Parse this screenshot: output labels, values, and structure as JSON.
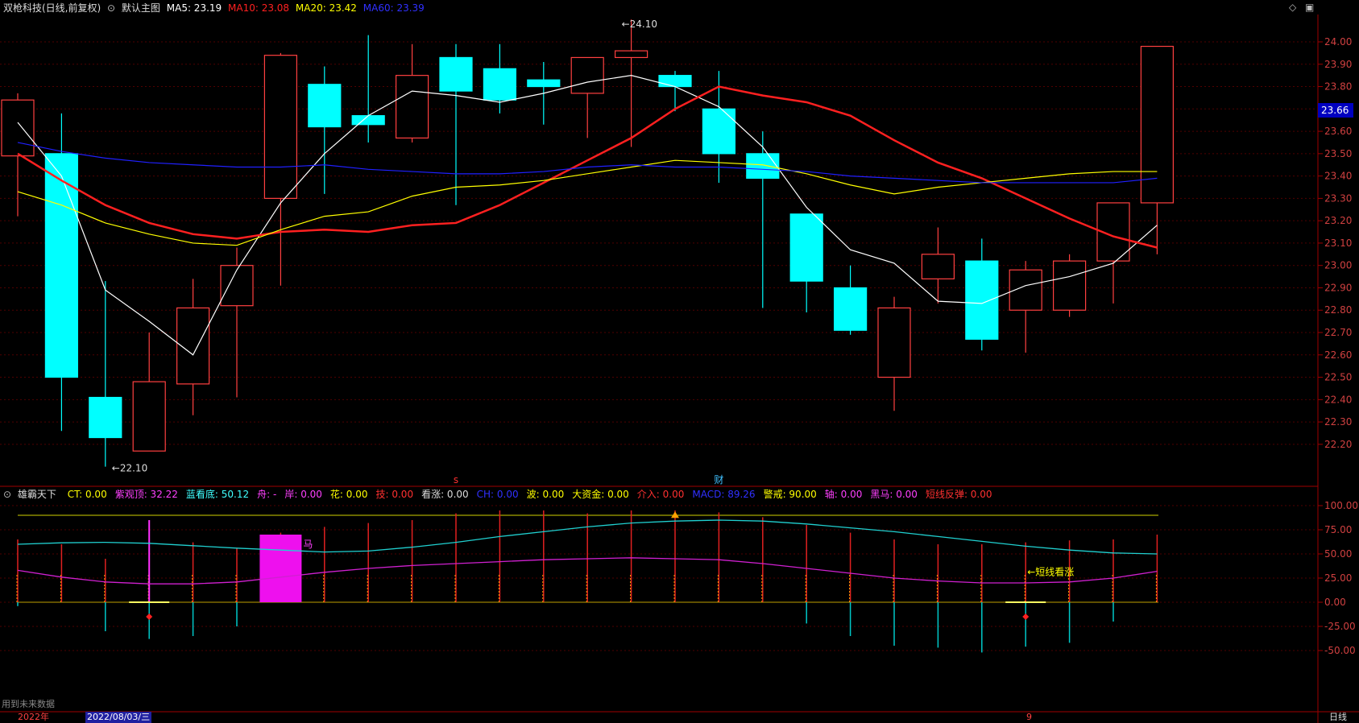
{
  "header": {
    "stock": "双枪科技(日线,前复权)",
    "main_label": "默认主图",
    "ma5": "MA5: 23.19",
    "ma10": "MA10: 23.08",
    "ma20": "MA20: 23.42",
    "ma60": "MA60: 23.39",
    "colors": {
      "ma5": "#ffffff",
      "ma10": "#ff2020",
      "ma20": "#ffff00",
      "ma60": "#3030ff"
    }
  },
  "indicator_header": {
    "name": "雄霸天下",
    "items": [
      {
        "text": "CT: 0.00",
        "color": "#ffff00"
      },
      {
        "text": "紫观顶: 32.22",
        "color": "#ff40ff"
      },
      {
        "text": "蓝看底: 50.12",
        "color": "#40ffff"
      },
      {
        "text": "舟: -",
        "color": "#ff40ff"
      },
      {
        "text": "岸: 0.00",
        "color": "#ff40ff"
      },
      {
        "text": "花: 0.00",
        "color": "#ffff00"
      },
      {
        "text": "技: 0.00",
        "color": "#ff3030"
      },
      {
        "text": "看涨: 0.00",
        "color": "#dddddd"
      },
      {
        "text": "CH: 0.00",
        "color": "#3030ff"
      },
      {
        "text": "波: 0.00",
        "color": "#ffff00"
      },
      {
        "text": "大资金: 0.00",
        "color": "#ffff00"
      },
      {
        "text": "介入: 0.00",
        "color": "#ff3030"
      },
      {
        "text": "MACD: 89.26",
        "color": "#3030ff"
      },
      {
        "text": "警戒: 90.00",
        "color": "#ffff00"
      },
      {
        "text": "轴: 0.00",
        "color": "#ff40ff"
      },
      {
        "text": "黑马: 0.00",
        "color": "#ff40ff"
      },
      {
        "text": "短线反弹: 0.00",
        "color": "#ff3030"
      }
    ]
  },
  "annotations": {
    "high_label": "24.10",
    "low_label": "22.10",
    "current_price": "23.66",
    "signal_s": "s",
    "signal_cai": "财",
    "short_bull": "←短线看涨",
    "ma_fragment": "马"
  },
  "footer": {
    "note": "用到未来数据",
    "year": "2022年",
    "date": "2022/08/03/三",
    "month_mark": "9",
    "period": "日线"
  },
  "chart_data": [
    {
      "type": "candlestick",
      "title": "",
      "ylim": [
        22.1,
        24.1
      ],
      "y_ticks": [
        22.2,
        22.3,
        22.4,
        22.5,
        22.6,
        22.7,
        22.8,
        22.9,
        23.0,
        23.1,
        23.2,
        23.3,
        23.4,
        23.5,
        23.6,
        23.7,
        23.8,
        23.9,
        24.0
      ],
      "candles": [
        {
          "o": 23.49,
          "h": 23.77,
          "l": 23.22,
          "c": 23.74
        },
        {
          "o": 23.5,
          "h": 23.68,
          "l": 22.26,
          "c": 22.5
        },
        {
          "o": 22.41,
          "h": 22.93,
          "l": 22.1,
          "c": 22.23
        },
        {
          "o": 22.17,
          "h": 22.7,
          "l": 22.17,
          "c": 22.48
        },
        {
          "o": 22.47,
          "h": 22.94,
          "l": 22.33,
          "c": 22.81
        },
        {
          "o": 22.82,
          "h": 23.08,
          "l": 22.41,
          "c": 23.0
        },
        {
          "o": 23.3,
          "h": 23.95,
          "l": 22.91,
          "c": 23.94
        },
        {
          "o": 23.81,
          "h": 23.89,
          "l": 23.32,
          "c": 23.62
        },
        {
          "o": 23.67,
          "h": 24.03,
          "l": 23.55,
          "c": 23.63
        },
        {
          "o": 23.57,
          "h": 23.99,
          "l": 23.55,
          "c": 23.85
        },
        {
          "o": 23.93,
          "h": 23.99,
          "l": 23.27,
          "c": 23.78
        },
        {
          "o": 23.88,
          "h": 23.99,
          "l": 23.68,
          "c": 23.74
        },
        {
          "o": 23.83,
          "h": 23.91,
          "l": 23.63,
          "c": 23.8
        },
        {
          "o": 23.77,
          "h": 23.92,
          "l": 23.57,
          "c": 23.93
        },
        {
          "o": 23.93,
          "h": 24.1,
          "l": 23.53,
          "c": 23.96
        },
        {
          "o": 23.85,
          "h": 23.87,
          "l": 23.69,
          "c": 23.8
        },
        {
          "o": 23.7,
          "h": 23.87,
          "l": 23.37,
          "c": 23.5
        },
        {
          "o": 23.5,
          "h": 23.6,
          "l": 22.81,
          "c": 23.39
        },
        {
          "o": 23.23,
          "h": 23.23,
          "l": 22.79,
          "c": 22.93
        },
        {
          "o": 22.9,
          "h": 23.0,
          "l": 22.69,
          "c": 22.71
        },
        {
          "o": 22.5,
          "h": 22.86,
          "l": 22.35,
          "c": 22.81
        },
        {
          "o": 22.94,
          "h": 23.17,
          "l": 22.83,
          "c": 23.05
        },
        {
          "o": 23.02,
          "h": 23.12,
          "l": 22.62,
          "c": 22.67
        },
        {
          "o": 22.8,
          "h": 23.02,
          "l": 22.61,
          "c": 22.98
        },
        {
          "o": 22.8,
          "h": 23.05,
          "l": 22.77,
          "c": 23.02
        },
        {
          "o": 23.02,
          "h": 23.28,
          "l": 22.83,
          "c": 23.28
        },
        {
          "o": 23.28,
          "h": 23.98,
          "l": 23.05,
          "c": 23.98
        }
      ],
      "series": [
        {
          "name": "MA5",
          "values": [
            23.64,
            23.4,
            22.89,
            22.75,
            22.6,
            22.98,
            23.28,
            23.5,
            23.67,
            23.78,
            23.76,
            23.73,
            23.77,
            23.82,
            23.85,
            23.8,
            23.71,
            23.53,
            23.26,
            23.07,
            23.01,
            22.84,
            22.83,
            22.91,
            22.95,
            23.01,
            23.18
          ]
        },
        {
          "name": "MA10",
          "values": [
            23.5,
            23.38,
            23.27,
            23.19,
            23.14,
            23.12,
            23.15,
            23.16,
            23.15,
            23.18,
            23.19,
            23.27,
            23.37,
            23.47,
            23.57,
            23.7,
            23.8,
            23.76,
            23.73,
            23.67,
            23.56,
            23.46,
            23.39,
            23.3,
            23.21,
            23.13,
            23.08
          ]
        },
        {
          "name": "MA20",
          "values": [
            23.33,
            23.27,
            23.19,
            23.14,
            23.1,
            23.09,
            23.16,
            23.22,
            23.24,
            23.31,
            23.35,
            23.36,
            23.38,
            23.41,
            23.44,
            23.47,
            23.46,
            23.45,
            23.41,
            23.36,
            23.32,
            23.35,
            23.37,
            23.39,
            23.41,
            23.42,
            23.42
          ]
        },
        {
          "name": "MA60",
          "values": [
            23.55,
            23.51,
            23.48,
            23.46,
            23.45,
            23.44,
            23.44,
            23.45,
            23.43,
            23.42,
            23.41,
            23.41,
            23.42,
            23.44,
            23.45,
            23.44,
            23.44,
            23.43,
            23.42,
            23.4,
            23.39,
            23.38,
            23.37,
            23.37,
            23.37,
            23.37,
            23.39
          ]
        }
      ]
    },
    {
      "type": "line",
      "title": "雄霸天下",
      "ylim": [
        -75,
        115
      ],
      "y_ticks": [
        100,
        75,
        50,
        25,
        0,
        -25,
        -50
      ],
      "warning_level": 90,
      "series": [
        {
          "name": "蓝看底",
          "values": [
            60,
            61.5,
            62,
            61,
            58.5,
            56,
            54,
            52,
            53,
            57,
            62,
            68,
            73,
            78,
            82,
            84,
            85,
            84,
            81,
            77,
            73,
            68,
            63,
            58,
            54,
            51,
            50
          ]
        },
        {
          "name": "紫观顶",
          "values": [
            33,
            26,
            21,
            19,
            19,
            21,
            26,
            31,
            35,
            38,
            40,
            42,
            44,
            45,
            46,
            45,
            44,
            40,
            35,
            30,
            25,
            22,
            20,
            20,
            21,
            25,
            32
          ]
        },
        {
          "name": "up_bars",
          "values": [
            65,
            60,
            45,
            62,
            62,
            56,
            72,
            78,
            82,
            85,
            92,
            95,
            95,
            92,
            95,
            95,
            93,
            88,
            80,
            72,
            65,
            60,
            60,
            62,
            64,
            65,
            70
          ]
        },
        {
          "name": "down_bars",
          "values": [
            -4,
            0,
            -30,
            -38,
            -35,
            -25,
            0,
            0,
            0,
            0,
            0,
            0,
            0,
            0,
            0,
            0,
            0,
            0,
            -22,
            -35,
            -45,
            -47,
            -52,
            -46,
            -42,
            -20,
            0
          ]
        }
      ],
      "magenta_block": {
        "from_index": 6,
        "to_index": 6,
        "top": 70
      }
    }
  ]
}
